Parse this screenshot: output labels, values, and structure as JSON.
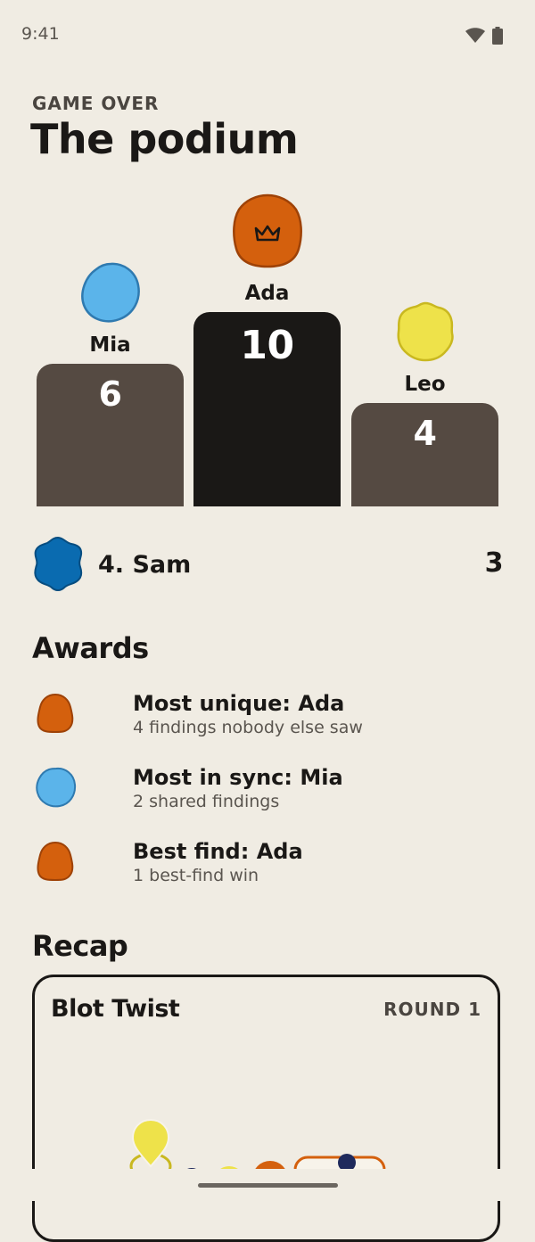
{
  "status_bar": {
    "time": "9:41",
    "wifi_icon": "wifi-icon",
    "battery_icon": "battery-icon"
  },
  "header": {
    "eyebrow": "GAME OVER",
    "title": "The podium"
  },
  "podium": {
    "first": {
      "name": "Ada",
      "score": "10",
      "color": "#d4600d",
      "icon": "crown-icon"
    },
    "second": {
      "name": "Mia",
      "score": "6",
      "color": "#5bb4ea"
    },
    "third": {
      "name": "Leo",
      "score": "4",
      "color": "#eee24a"
    },
    "first_block_color": "#1a1816",
    "other_block_color": "#554a42"
  },
  "runner_up": {
    "label": "4. Sam",
    "score": "3",
    "color": "#0a6bb0"
  },
  "awards": {
    "heading": "Awards",
    "items": [
      {
        "title": "Most unique: Ada",
        "subtitle": "4 findings nobody else saw",
        "color": "#d4600d"
      },
      {
        "title": "Most in sync: Mia",
        "subtitle": "2 shared findings",
        "color": "#5bb4ea"
      },
      {
        "title": "Best find: Ada",
        "subtitle": "1 best-find win",
        "color": "#d4600d"
      }
    ]
  },
  "recap": {
    "heading": "Recap",
    "card_title": "Blot Twist",
    "round_label": "ROUND 1"
  }
}
